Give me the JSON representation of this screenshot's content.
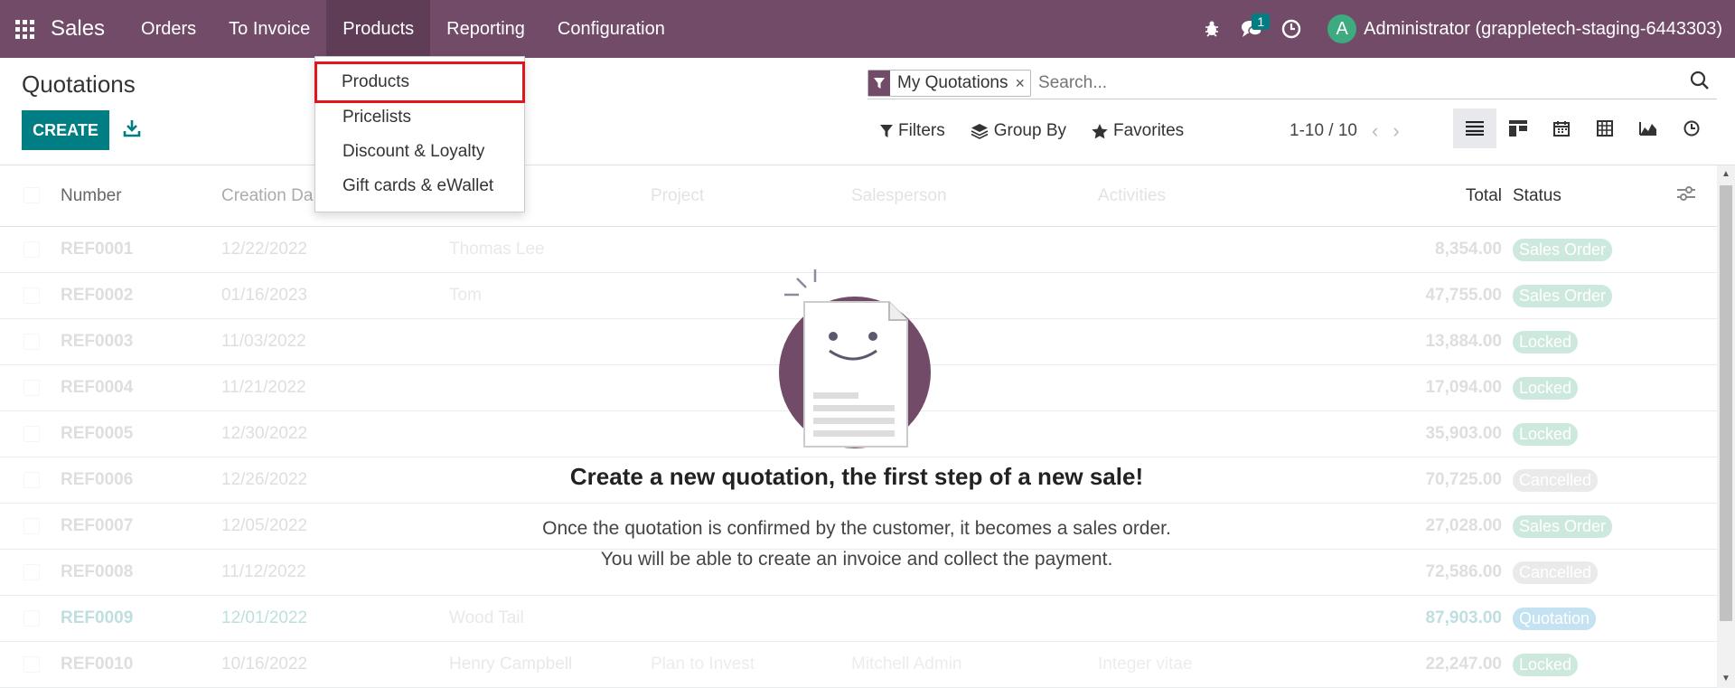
{
  "navbar": {
    "app_name": "Sales",
    "menu": [
      "Orders",
      "To Invoice",
      "Products",
      "Reporting",
      "Configuration"
    ],
    "active_menu": "Products",
    "messages_badge": "1",
    "avatar_letter": "A",
    "user_name": "Administrator (grappletech-staging-6443303)",
    "bg_color": "#714b67"
  },
  "control": {
    "title": "Quotations",
    "create_label": "CREATE",
    "facet_label": "My Quotations",
    "facet_close": "×",
    "search_placeholder": "Search...",
    "filters_label": "Filters",
    "groupby_label": "Group By",
    "favorites_label": "Favorites",
    "pager": "1-10 / 10",
    "accent": "#017e84"
  },
  "dropdown": {
    "items": [
      "Products",
      "Pricelists",
      "Discount & Loyalty",
      "Gift cards & eWallet"
    ],
    "highlighted": "Products",
    "highlight_color": "#e0161b"
  },
  "list": {
    "headers": {
      "number": "Number",
      "creation_date": "Creation Da",
      "project": "Project",
      "salesperson": "Salesperson",
      "activities": "Activities",
      "total": "Total",
      "status": "Status"
    },
    "rows": [
      {
        "number": "REF0001",
        "date": "12/22/2022",
        "customer": "Thomas Lee",
        "total": "8,354.00",
        "status": "Sales Order",
        "status_color": "#3daa7f"
      },
      {
        "number": "REF0002",
        "date": "01/16/2023",
        "customer": "Tom",
        "total": "47,755.00",
        "status": "Sales Order",
        "status_color": "#3daa7f"
      },
      {
        "number": "REF0003",
        "date": "11/03/2022",
        "customer": "",
        "total": "13,884.00",
        "status": "Locked",
        "status_color": "#3daa7f"
      },
      {
        "number": "REF0004",
        "date": "11/21/2022",
        "customer": "",
        "total": "17,094.00",
        "status": "Locked",
        "status_color": "#3daa7f"
      },
      {
        "number": "REF0005",
        "date": "12/30/2022",
        "customer": "",
        "total": "35,903.00",
        "status": "Locked",
        "status_color": "#3daa7f"
      },
      {
        "number": "REF0006",
        "date": "12/26/2022",
        "customer": "",
        "total": "70,725.00",
        "status": "Cancelled",
        "status_color": "#999999"
      },
      {
        "number": "REF0007",
        "date": "12/05/2022",
        "customer": "",
        "total": "27,028.00",
        "status": "Sales Order",
        "status_color": "#3daa7f"
      },
      {
        "number": "REF0008",
        "date": "11/12/2022",
        "customer": "",
        "total": "72,586.00",
        "status": "Cancelled",
        "status_color": "#999999"
      },
      {
        "number": "REF0009",
        "date": "12/01/2022",
        "customer": "Wood Tail",
        "total": "87,903.00",
        "status": "Quotation",
        "status_color": "#2e9bcf"
      },
      {
        "number": "REF0010",
        "date": "10/16/2022",
        "customer": "Henry Campbell",
        "total": "22,247.00",
        "status": "Locked",
        "status_color": "#3daa7f"
      }
    ],
    "row10_extra": {
      "project": "Plan to Invest",
      "salesperson": "Mitchell Admin",
      "activity": "Integer vitae"
    }
  },
  "helper": {
    "title": "Create a new quotation, the first step of a new sale!",
    "line1": "Once the quotation is confirmed by the customer, it becomes a sales order.",
    "line2": "You will be able to create an invoice and collect the payment."
  }
}
